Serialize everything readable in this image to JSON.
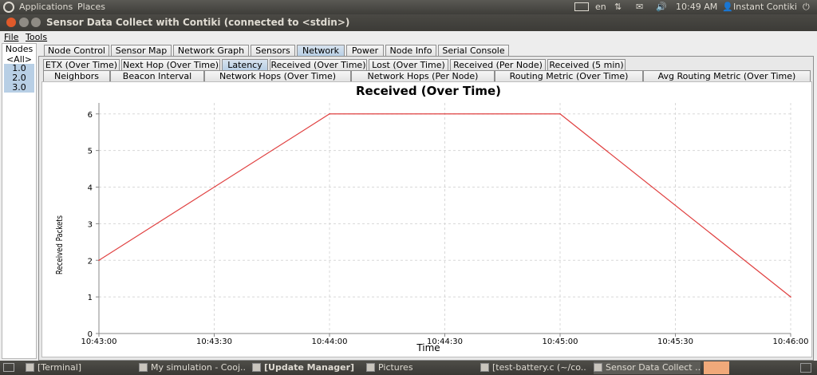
{
  "top_panel": {
    "applications": "Applications",
    "places": "Places",
    "lang": "en",
    "time": "10:49 AM",
    "user": "Instant Contiki"
  },
  "window": {
    "title": "Sensor Data Collect with Contiki (connected to <stdin>)"
  },
  "menu": {
    "file": "File",
    "tools": "Tools"
  },
  "nodes": {
    "header": "Nodes",
    "all": "<All>",
    "items": [
      "1.0",
      "2.0",
      "3.0"
    ]
  },
  "main_tabs": [
    "Node Control",
    "Sensor Map",
    "Network Graph",
    "Sensors",
    "Network",
    "Power",
    "Node Info",
    "Serial Console"
  ],
  "sub_tabs_row1": [
    "ETX (Over Time)",
    "Next Hop (Over Time)",
    "Latency",
    "Received (Over Time)",
    "Lost (Over Time)",
    "Received (Per Node)",
    "Received (5 min)"
  ],
  "sub_tabs_row2": [
    "Neighbors",
    "Beacon Interval",
    "Network Hops (Over Time)",
    "Network Hops (Per Node)",
    "Routing Metric (Over Time)",
    "Avg Routing Metric (Over Time)"
  ],
  "chart_data": {
    "type": "line",
    "title": "Received (Over Time)",
    "xlabel": "Time",
    "ylabel": "Received Packets",
    "x": [
      "10:43:00",
      "10:44:00",
      "10:45:00",
      "10:46:00"
    ],
    "y": [
      2,
      6,
      6,
      1
    ],
    "xticks": [
      "10:43:00",
      "10:43:30",
      "10:44:00",
      "10:44:30",
      "10:45:00",
      "10:45:30",
      "10:46:00"
    ],
    "yticks": [
      0,
      1,
      2,
      3,
      4,
      5,
      6
    ],
    "ylim": [
      0,
      6.3
    ],
    "grid": true,
    "line_color": "#e04040"
  },
  "taskbar": [
    "[Terminal]",
    "My simulation - Cooj...",
    "[Update Manager]",
    "Pictures",
    "[test-battery.c (~/co...",
    "Sensor Data Collect ..."
  ]
}
